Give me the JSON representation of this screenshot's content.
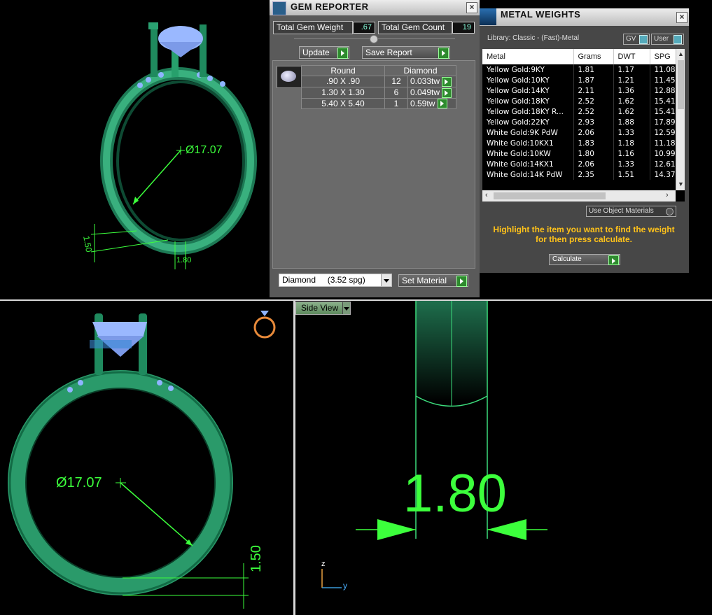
{
  "gem_reporter": {
    "title": "GEM REPORTER",
    "close": "×",
    "total_gem_weight_label": "Total Gem Weight",
    "total_gem_weight_value": ".67",
    "total_gem_count_label": "Total Gem Count",
    "total_gem_count_value": "19",
    "update_label": "Update",
    "save_report_label": "Save Report",
    "headers": {
      "shape": "Round",
      "material": "Diamond"
    },
    "rows": [
      {
        "size": ".90 X .90",
        "count": "12",
        "weight": "0.033tw"
      },
      {
        "size": "1.30 X 1.30",
        "count": "6",
        "weight": "0.049tw"
      },
      {
        "size": "5.40 X 5.40",
        "count": "1",
        "weight": "0.59tw"
      }
    ],
    "material_select": "Diamond     (3.52 spg)",
    "set_material_label": "Set Material"
  },
  "metal_weights": {
    "title": "METAL WEIGHTS",
    "close": "×",
    "library": "Library: Classic - (Fast)-Metal",
    "gv_label": "GV",
    "user_label": "User",
    "columns": [
      "Metal",
      "Grams",
      "DWT",
      "SPG"
    ],
    "rows": [
      [
        "Yellow Gold:9KY",
        "1.81",
        "1.17",
        "11.08"
      ],
      [
        "Yellow Gold:10KY",
        "1.87",
        "1.21",
        "11.45"
      ],
      [
        "Yellow Gold:14KY",
        "2.11",
        "1.36",
        "12.88"
      ],
      [
        "Yellow Gold:18KY",
        "2.52",
        "1.62",
        "15.41"
      ],
      [
        "Yellow Gold:18KY R...",
        "2.52",
        "1.62",
        "15.41"
      ],
      [
        "Yellow Gold:22KY",
        "2.93",
        "1.88",
        "17.89"
      ],
      [
        "White Gold:9K PdW",
        "2.06",
        "1.33",
        "12.59"
      ],
      [
        "White Gold:10KX1",
        "1.83",
        "1.18",
        "11.18"
      ],
      [
        "White Gold:10KW",
        "1.80",
        "1.16",
        "10.99"
      ],
      [
        "White Gold:14KX1",
        "2.06",
        "1.33",
        "12.61"
      ],
      [
        "White Gold:14K PdW",
        "2.35",
        "1.51",
        "14.37"
      ]
    ],
    "use_object_materials_label": "Use Object Materials",
    "hint": "Highlight the item you want to find the weight for then press calculate.",
    "calculate_label": "Calculate"
  },
  "viewports": {
    "perspective_diameter": "Ø17.07",
    "perspective_width": "1.50",
    "perspective_thickness": "1.80",
    "front_diameter": "Ø17.07",
    "front_width": "1.50",
    "side_view_label": "Side View",
    "side_thickness": "1.80",
    "axis_z": "z",
    "axis_y": "y"
  },
  "colors": {
    "ring_green": "#2fa874",
    "dim_green": "#3cff3c",
    "gem_blue": "#9ab8ff",
    "hint_yellow": "#ffc21a",
    "panel_gray": "#5a5a5a"
  }
}
